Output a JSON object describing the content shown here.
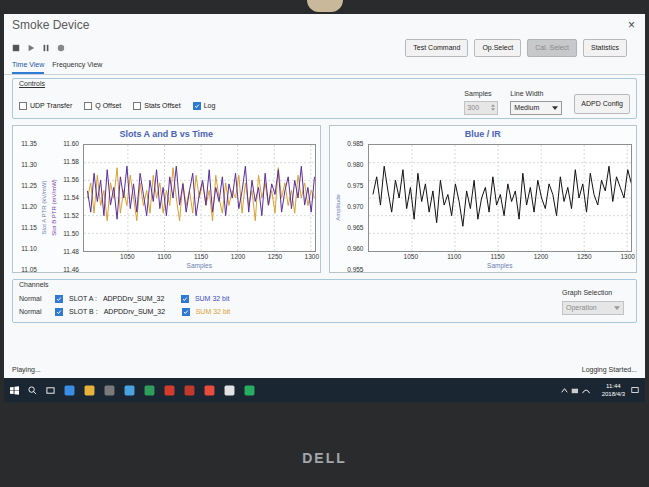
{
  "window": {
    "title": "Smoke Device",
    "close": "×"
  },
  "buttons": [
    {
      "label": "Test Command",
      "disabled": false
    },
    {
      "label": "Op.Select",
      "disabled": false
    },
    {
      "label": "Cal. Select",
      "disabled": true
    },
    {
      "label": "Statistics",
      "disabled": false
    }
  ],
  "tabs": [
    {
      "label": "Time View",
      "selected": true
    },
    {
      "label": "Frequency View",
      "selected": false
    }
  ],
  "controls": {
    "title": "Controls",
    "checkboxes": [
      {
        "label": "UDP Transfer",
        "checked": false
      },
      {
        "label": "Q Offset",
        "checked": false
      },
      {
        "label": "Stats Offset",
        "checked": false
      },
      {
        "label": "Log",
        "checked": true
      }
    ],
    "samples": {
      "label": "Samples",
      "value": "300",
      "disabled": true
    },
    "line_width": {
      "label": "Line Width",
      "value": "Medium"
    },
    "config_button": "ADPD Config"
  },
  "charts": [
    {
      "title": "Slots A and B vs Time",
      "x_label": "Samples",
      "x_min": 990,
      "x_max": 1305,
      "x_ticks": [
        "1050",
        "1100",
        "1150",
        "1200",
        "1250",
        "1300"
      ],
      "y_axes": [
        {
          "label": "Slot A PTR (kV/mW)",
          "color": "#6b7fb4",
          "min": 11.05,
          "max": 11.35,
          "ticks": [
            "11.35",
            "11.30",
            "11.25",
            "11.20",
            "11.15",
            "11.10",
            "11.05"
          ]
        },
        {
          "label": "Slot B PTR (mV/mW)",
          "color": "#7a3fb0",
          "min": 11.46,
          "max": 11.6,
          "ticks": [
            "11.60",
            "11.58",
            "11.56",
            "11.54",
            "11.52",
            "11.50",
            "11.48",
            "11.46"
          ]
        }
      ],
      "series": [
        {
          "name": "SLOT B",
          "color": "#d9a030",
          "axis": 1,
          "values": [
            11.53,
            11.55,
            11.51,
            11.56,
            11.52,
            11.54,
            11.5,
            11.55,
            11.53,
            11.57,
            11.51,
            11.54,
            11.52,
            11.56,
            11.53,
            11.5,
            11.55,
            11.52,
            11.54,
            11.51,
            11.56,
            11.53,
            11.55,
            11.51,
            11.54,
            11.52,
            11.57,
            11.53,
            11.5,
            11.55,
            11.52,
            11.54,
            11.51,
            11.56,
            11.53,
            11.55,
            11.52,
            11.54,
            11.5,
            11.56,
            11.53,
            11.51,
            11.55,
            11.52,
            11.54,
            11.53,
            11.56,
            11.51,
            11.55,
            11.52,
            11.54,
            11.5,
            11.56,
            11.53,
            11.55,
            11.52,
            11.54,
            11.51,
            11.57,
            11.53,
            11.55,
            11.52,
            11.54,
            11.51,
            11.56,
            11.53,
            11.55,
            11.52,
            11.54,
            11.53
          ]
        },
        {
          "name": "SLOT A",
          "color": "#5a2ca0",
          "axis": 0,
          "values": [
            11.22,
            11.16,
            11.27,
            11.19,
            11.25,
            11.15,
            11.28,
            11.18,
            11.23,
            11.14,
            11.26,
            11.2,
            11.29,
            11.17,
            11.24,
            11.16,
            11.27,
            11.21,
            11.15,
            11.25,
            11.19,
            11.28,
            11.17,
            11.23,
            11.15,
            11.26,
            11.2,
            11.29,
            11.18,
            11.24,
            11.16,
            11.22,
            11.27,
            11.15,
            11.21,
            11.25,
            11.18,
            11.28,
            11.16,
            11.23,
            11.19,
            11.26,
            11.15,
            11.24,
            11.2,
            11.27,
            11.17,
            11.22,
            11.29,
            11.16,
            11.25,
            11.19,
            11.23,
            11.15,
            11.27,
            11.18,
            11.24,
            11.21,
            11.28,
            11.16,
            11.22,
            11.26,
            11.17,
            11.25,
            11.2,
            11.29,
            11.18,
            11.23,
            11.16,
            11.26
          ]
        }
      ]
    },
    {
      "title": "Blue / IR",
      "x_label": "Samples",
      "x_min": 1000,
      "x_max": 1305,
      "x_ticks": [
        "1050",
        "1100",
        "1150",
        "1200",
        "1250",
        "1300"
      ],
      "y_axes": [
        {
          "label": "Amplitude",
          "color": "#6b7fb4",
          "min": 0.955,
          "max": 0.985,
          "ticks": [
            "0.985",
            "0.980",
            "0.975",
            "0.970",
            "0.965",
            "0.960",
            "0.955"
          ]
        }
      ],
      "series": [
        {
          "name": "Blue / IR",
          "color": "#111111",
          "axis": 0,
          "values": [
            0.971,
            0.976,
            0.968,
            0.979,
            0.972,
            0.966,
            0.975,
            0.97,
            0.978,
            0.967,
            0.973,
            0.964,
            0.977,
            0.969,
            0.974,
            0.966,
            0.972,
            0.963,
            0.975,
            0.968,
            0.971,
            0.965,
            0.974,
            0.969,
            0.962,
            0.972,
            0.967,
            0.975,
            0.964,
            0.97,
            0.973,
            0.966,
            0.976,
            0.968,
            0.971,
            0.965,
            0.974,
            0.969,
            0.972,
            0.964,
            0.977,
            0.968,
            0.973,
            0.966,
            0.975,
            0.97,
            0.967,
            0.974,
            0.971,
            0.965,
            0.976,
            0.969,
            0.973,
            0.967,
            0.978,
            0.97,
            0.974,
            0.966,
            0.977,
            0.971,
            0.968,
            0.975,
            0.972,
            0.979,
            0.969,
            0.976,
            0.973,
            0.97,
            0.978,
            0.974
          ]
        }
      ]
    }
  ],
  "channels": {
    "title": "Channels",
    "rows": [
      {
        "mode": "Normal",
        "slot": "SLOT A :",
        "source": "ADPDDrv_SUM_32",
        "checked": true,
        "format": "SUM 32 bit",
        "color": "#3f4fc0"
      },
      {
        "mode": "Normal",
        "slot": "SLOT B :",
        "source": "ADPDDrv_SUM_32",
        "checked": true,
        "format": "SUM 32 bit",
        "color": "#e0a030"
      }
    ]
  },
  "graph_selection": {
    "label": "Graph Selection",
    "value": "Operation",
    "disabled": true
  },
  "status": {
    "left": "Playing...",
    "right": "Logging Started..."
  },
  "taskbar": {
    "time": "11:44",
    "date": "2018/4/3"
  },
  "bezel": {
    "logo": "DELL"
  }
}
